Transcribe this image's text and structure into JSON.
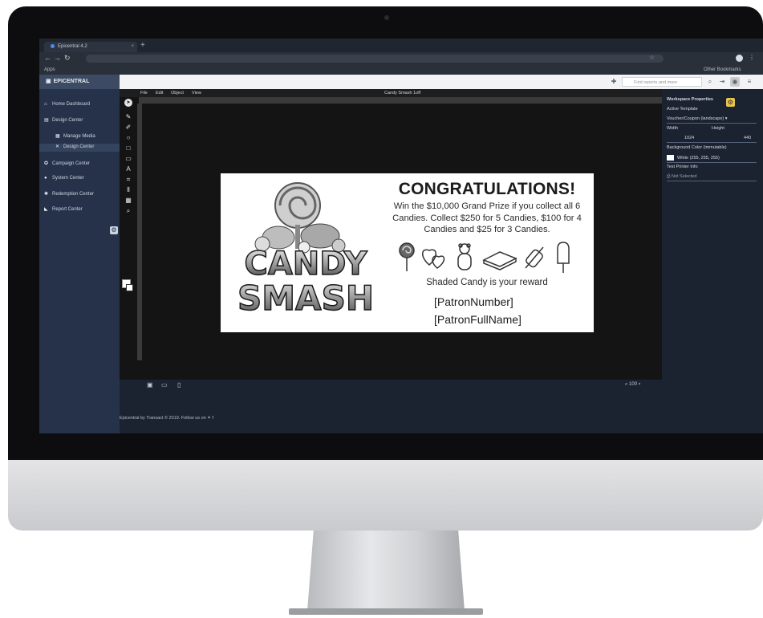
{
  "browser": {
    "tab_title": "Epicentral 4.2",
    "tab_close": "×",
    "new_tab": "+",
    "bookmarks_apps": "Apps",
    "bookmarks_other": "Other Bookmarks"
  },
  "app": {
    "brand": "EPICENTRAL",
    "search_placeholder": "Find reports and more"
  },
  "sidebar": {
    "items": [
      {
        "label": "Home Dashboard"
      },
      {
        "label": "Design Center"
      },
      {
        "label": "Manage Media"
      },
      {
        "label": "Design Center"
      },
      {
        "label": "Campaign Center"
      },
      {
        "label": "System Center"
      },
      {
        "label": "Redemption Center"
      },
      {
        "label": "Report Center"
      }
    ]
  },
  "designer": {
    "menu": [
      "File",
      "Edit",
      "Object",
      "View"
    ],
    "document_title": "Candy Smash 1off",
    "zoom": "100"
  },
  "voucher": {
    "logo_line1": "CANDY",
    "logo_line2": "SMASH",
    "title": "CONGRATULATIONS!",
    "description": "Win the $10,000 Grand Prize if you collect all 6 Candies. Collect $250 for 5 Candies, $100 for 4 Candies and $25 for 3 Candies.",
    "reward": "Shaded Candy is your reward",
    "field1": "[PatronNumber]",
    "field2": "[PatronFullName]"
  },
  "properties": {
    "heading": "Workspace Properties",
    "active_template_label": "Active Template",
    "active_template_value": "Voucher/Coupon (landscape)",
    "width_label": "Width",
    "height_label": "Height",
    "width_value": "1024",
    "height_value": "440",
    "bg_label": "Background Color (immutable)",
    "bg_value": "White (255, 255, 255)",
    "printer_label": "Test Printer Info",
    "printer_value": "Not Selected"
  },
  "footer": {
    "text": "Epicentral by Transact © 2019. Follow us on"
  },
  "colors": {
    "sidebar": "#25324a",
    "accent_gear": "#e8c44a"
  }
}
